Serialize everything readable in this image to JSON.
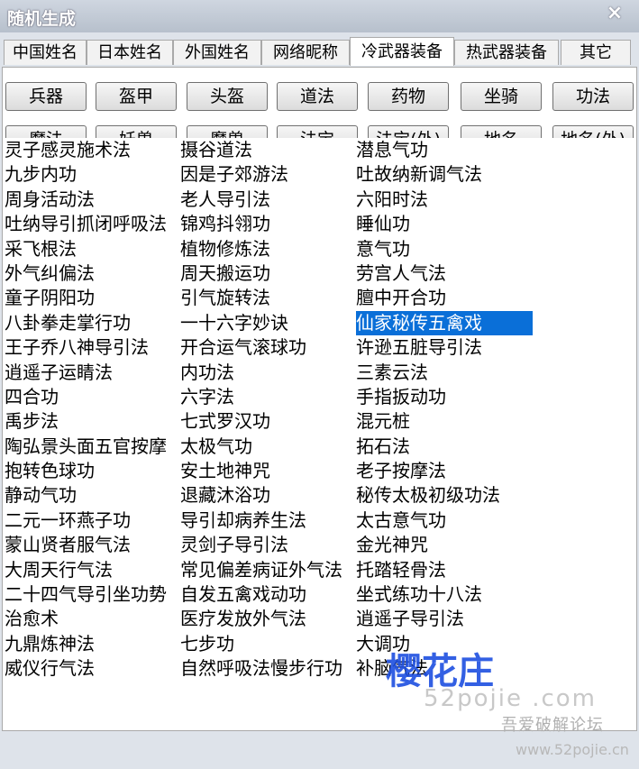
{
  "window": {
    "title": "随机生成",
    "close_label": "×"
  },
  "tabs": [
    {
      "label": "中国姓名"
    },
    {
      "label": "日本姓名"
    },
    {
      "label": "外国姓名"
    },
    {
      "label": "网络昵称"
    },
    {
      "label": "冷武器装备",
      "active": true
    },
    {
      "label": "热武器装备"
    },
    {
      "label": "其它"
    }
  ],
  "buttons_row1": [
    "兵器",
    "盔甲",
    "头盔",
    "道法",
    "药物",
    "坐骑",
    "功法"
  ],
  "buttons_row2": [
    "魔法",
    "妖兽",
    "魔兽",
    "法宝",
    "法宝(外)",
    "地名",
    "地名(外)"
  ],
  "list": {
    "col1": [
      "灵子感灵施术法",
      "九步内功",
      "周身活动法",
      "吐纳导引抓闭呼吸法",
      "采飞根法",
      "外气纠偏法",
      "童子阴阳功",
      "八卦拳走掌行功",
      "王子乔八神导引法",
      "逍遥子运睛法",
      "四合功",
      "禹步法",
      "陶弘景头面五官按摩",
      "抱转色球功",
      "静动气功",
      "二元一环燕子功",
      "蒙山贤者服气法",
      "大周天行气法",
      "二十四气导引坐功势",
      "治愈术",
      "九鼎炼神法",
      "威仪行气法"
    ],
    "col2": [
      "摄谷道法",
      "因是子郊游法",
      "老人导引法",
      "锦鸡抖翎功",
      "植物修炼法",
      "周天搬运功",
      "引气旋转法",
      "一十六字妙诀",
      "开合运气滚球功",
      "内功法",
      "六字法",
      "七式罗汉功",
      "太极气功",
      "安土地神咒",
      "退藏沐浴功",
      "导引却病养生法",
      "灵剑子导引法",
      "常见偏差病证外气法",
      "自发五禽戏动功",
      "医疗发放外气法",
      "七步功",
      "自然呼吸法慢步行功"
    ],
    "col3": [
      "潜息气功",
      "吐故纳新调气法",
      "六阳时法",
      "睡仙功",
      "意气功",
      "劳宫人气法",
      "膻中开合功",
      "仙家秘传五禽戏",
      "许逊五脏导引法",
      "三素云法",
      "手指扳动功",
      "混元桩",
      "拓石法",
      "老子按摩法",
      "秘传太极初级功法",
      "太古意气功",
      "金光神咒",
      "托踏轻骨法",
      "坐式练功十八法",
      "逍遥子导引法",
      "大调功",
      "补脑气法"
    ],
    "selected": "仙家秘传五禽戏"
  },
  "watermark": {
    "brand": "樱花庄",
    "cn": "吾爱破解论坛",
    "url": "www.52pojie.cn",
    "faint": "52pojie .com"
  }
}
